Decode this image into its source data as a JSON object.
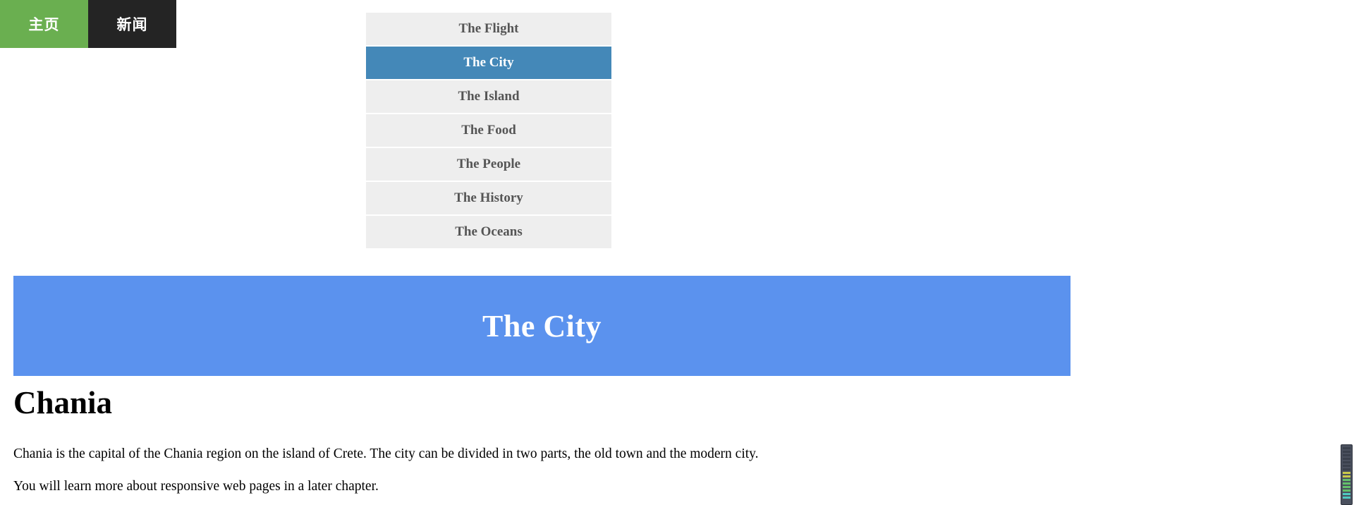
{
  "tabs": [
    {
      "label": "主页",
      "name": "tab-home",
      "active": true,
      "color": "#6aaf50"
    },
    {
      "label": "新闻",
      "name": "tab-news",
      "active": false,
      "color": "#242424"
    }
  ],
  "nav": {
    "items": [
      {
        "label": "The Flight",
        "active": false
      },
      {
        "label": "The City",
        "active": true
      },
      {
        "label": "The Island",
        "active": false
      },
      {
        "label": "The Food",
        "active": false
      },
      {
        "label": "The People",
        "active": false
      },
      {
        "label": "The History",
        "active": false
      },
      {
        "label": "The Oceans",
        "active": false
      }
    ],
    "active_color": "#4488b8",
    "inactive_color": "#eeeeee"
  },
  "banner": {
    "title": "The City",
    "background": "#5b92ee",
    "text_color": "#ffffff"
  },
  "article": {
    "heading": "Chania",
    "paragraph1": "Chania is the capital of the Chania region on the island of Crete. The city can be divided in two parts, the old town and the modern city.",
    "paragraph2": "You will learn more about responsive web pages in a later chapter."
  },
  "corner_widget": {
    "name": "scroll-indicator",
    "segments": [
      "d",
      "d",
      "d",
      "d",
      "d",
      "d",
      "d",
      "y",
      "y",
      "g",
      "g",
      "g",
      "g",
      "t",
      "t"
    ]
  }
}
